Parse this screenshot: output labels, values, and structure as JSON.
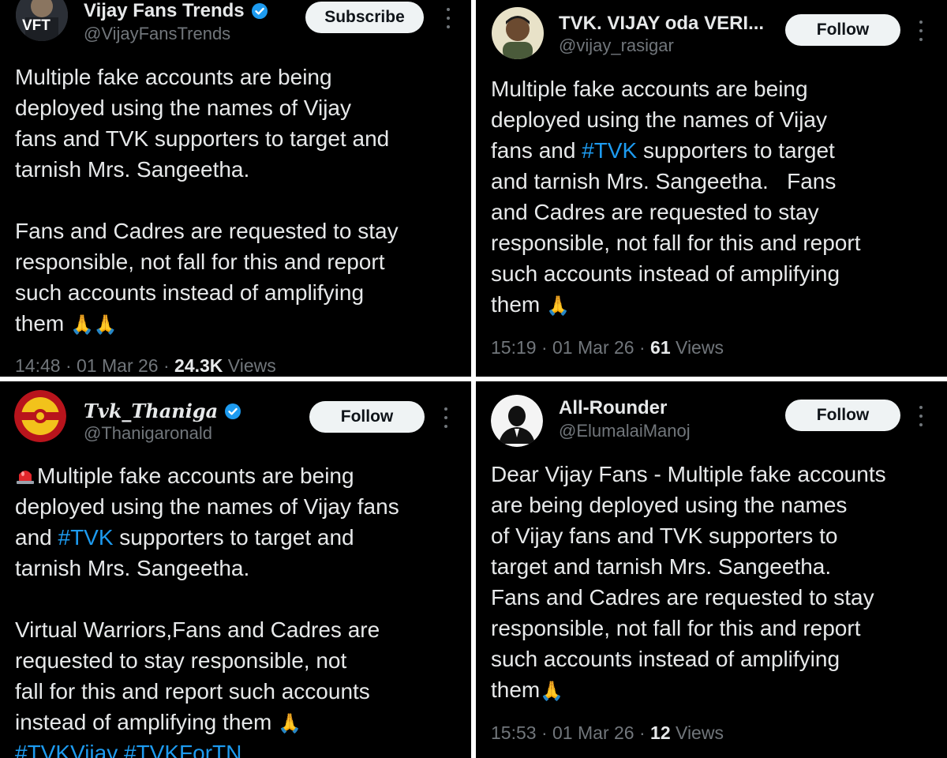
{
  "posts": [
    {
      "name": "Vijay Fans Trends",
      "verified": true,
      "handle": "@VijayFansTrends",
      "avatar_text": "VFT",
      "button": "Subscribe",
      "lines": [
        "Multiple fake accounts are being",
        "deployed using the names of Vijay",
        "fans and TVK supporters to target and",
        "tarnish Mrs. Sangeetha.",
        "",
        "Fans and Cadres are requested to stay",
        "responsible, not fall for this and report",
        "such accounts instead of amplifying",
        "them"
      ],
      "emoji": "🙏🙏",
      "time": "14:48",
      "date": "01 Mar 26",
      "views_count": "24.3K",
      "views_label": "Views"
    },
    {
      "name": "TVK. VIJAY oda VERI...",
      "verified": false,
      "handle": "@vijay_rasigar",
      "button": "Follow",
      "line1": "Multiple fake accounts are being",
      "line2": "deployed using the names of Vijay",
      "line3_pre": "fans and ",
      "line3_tag": "#TVK",
      "line3_post": " supporters to target",
      "line4": "and tarnish Mrs. Sangeetha.   Fans",
      "line5": "and Cadres are requested to stay",
      "line6": "responsible, not fall for this and report",
      "line7": "such accounts instead of amplifying",
      "line8": "them",
      "emoji": "🙏",
      "time": "15:19",
      "date": "01 Mar 26",
      "views_count": "61",
      "views_label": "Views"
    },
    {
      "name": "Tvk_Thaniga",
      "verified": true,
      "handle": "@Thanigaronald",
      "button": "Follow",
      "line1": "Multiple fake accounts are being",
      "line2": "deployed using the names of Vijay fans",
      "line3_pre": "and ",
      "line3_tag": "#TVK",
      "line3_post": " supporters to target and",
      "line4": "tarnish Mrs. Sangeetha.",
      "line6": "Virtual Warriors,Fans and Cadres are",
      "line7": "requested to stay responsible, not",
      "line8": "fall for this and report such accounts",
      "line9": "instead of amplifying them",
      "emoji": "🙏",
      "tags": "#TVKVijay #TVKForTN"
    },
    {
      "name": "All-Rounder",
      "verified": false,
      "handle": "@ElumalaiManoj",
      "button": "Follow",
      "lines": [
        "Dear Vijay Fans - Multiple fake accounts",
        "are being deployed using the names",
        "of Vijay fans and TVK supporters to",
        "target and tarnish Mrs. Sangeetha.",
        "Fans and Cadres are requested to stay",
        "responsible, not fall for this and report",
        "such accounts instead of amplifying",
        "them"
      ],
      "emoji": "🙏",
      "time": "15:53",
      "date": "01 Mar 26",
      "views_count": "12",
      "views_label": "Views"
    }
  ],
  "colors": {
    "background": "#000000",
    "text": "#e7e9ea",
    "secondary": "#71767b",
    "hashtag": "#1d9bf0",
    "verified": "#1d9bf0",
    "button_bg": "#eff3f4"
  },
  "icons": [
    "verified-badge-icon",
    "more-options-icon",
    "siren-emoji-icon",
    "folded-hands-emoji"
  ]
}
